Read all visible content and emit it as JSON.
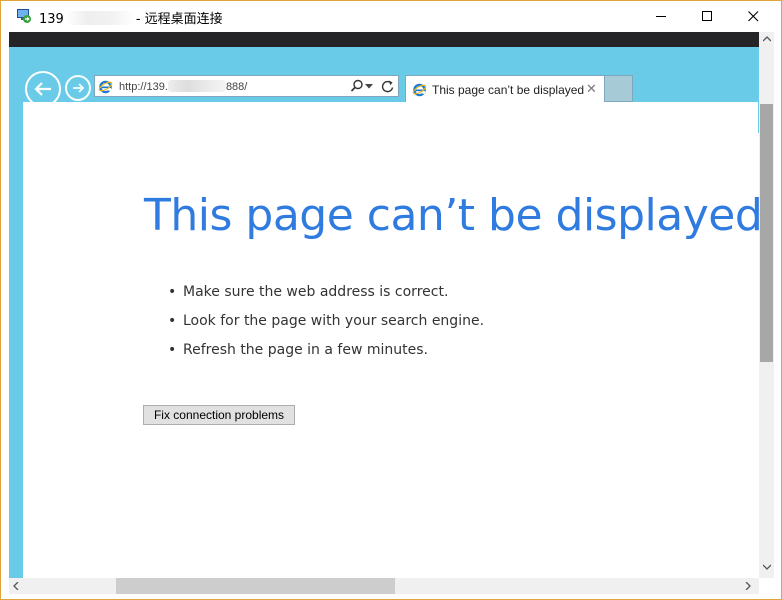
{
  "window": {
    "title_prefix": "139",
    "title_suffix": "- 远程桌面连接",
    "minimize_label": "minimize",
    "maximize_label": "maximize",
    "close_label": "close"
  },
  "browser": {
    "address": {
      "url_prefix": "http://139.",
      "url_suffix": "888/"
    },
    "tab": {
      "title": "This page can’t be displayed",
      "close_glyph": "✕"
    }
  },
  "content": {
    "heading": "This page can’t be displayed",
    "bullets": [
      "Make sure the web address is correct.",
      "Look for the page with your search engine.",
      "Refresh the page in a few minutes."
    ],
    "fix_button": "Fix connection problems"
  },
  "colors": {
    "window_border": "#e1a33a",
    "ie_chrome": "#69cbe8",
    "heading": "#2f7be0",
    "remote_bar": "#252527"
  },
  "icons": [
    "remote-desktop-icon",
    "minimize-icon",
    "maximize-icon",
    "close-icon",
    "back-arrow-icon",
    "forward-arrow-icon",
    "ie-logo-icon",
    "search-icon",
    "dropdown-icon",
    "refresh-icon"
  ]
}
